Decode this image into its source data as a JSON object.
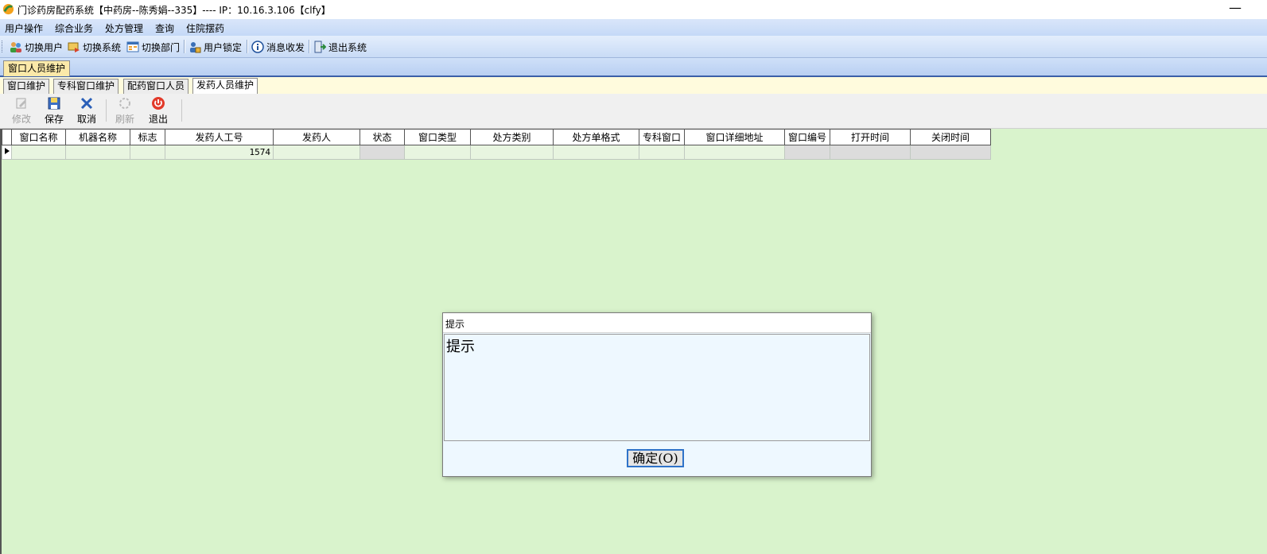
{
  "window": {
    "title": "门诊药房配药系统【中药房--陈秀娟--335】---- IP：10.16.3.106【clfy】",
    "minimize_glyph": "—"
  },
  "menu": {
    "items": [
      "用户操作",
      "综合业务",
      "处方管理",
      "查询",
      "住院摆药"
    ]
  },
  "toolbar": {
    "switch_user": "切换用户",
    "switch_system": "切换系统",
    "switch_dept": "切换部门",
    "user_lock": "用户锁定",
    "messages": "消息收发",
    "exit_system": "退出系统"
  },
  "document_tab": {
    "label": "窗口人员维护"
  },
  "inner_tabs": [
    {
      "label": "窗口维护",
      "active": false
    },
    {
      "label": "专科窗口维护",
      "active": false
    },
    {
      "label": "配药窗口人员",
      "active": false
    },
    {
      "label": "发药人员维护",
      "active": true
    }
  ],
  "actions": {
    "edit": "修改",
    "save": "保存",
    "cancel": "取消",
    "refresh": "刷新",
    "exit": "退出"
  },
  "grid": {
    "columns": [
      "窗口名称",
      "机器名称",
      "标志",
      "发药人工号",
      "发药人",
      "状态",
      "窗口类型",
      "处方类别",
      "处方单格式",
      "专科窗口",
      "窗口详细地址",
      "窗口编号",
      "打开时间",
      "关闭时间"
    ],
    "rows": [
      [
        "",
        "",
        "",
        "1574",
        "",
        "",
        "",
        "",
        "",
        "",
        "",
        "",
        "",
        ""
      ]
    ]
  },
  "dialog": {
    "title": "提示",
    "message": "提示",
    "ok_label": "确定(O)"
  },
  "colors": {
    "grid_background": "#d9f3cc",
    "dialog_background": "#eef8ff",
    "active_doc_tab": "#fbe9a9"
  }
}
